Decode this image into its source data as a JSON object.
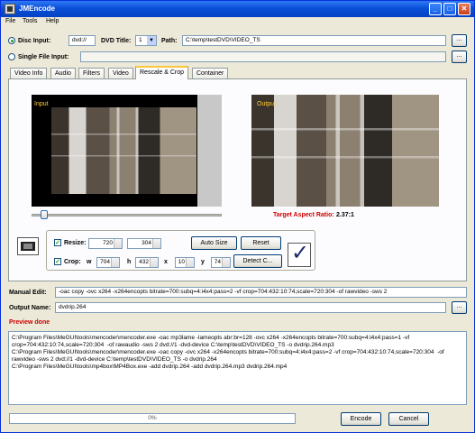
{
  "window": {
    "title": "JMEncode"
  },
  "menu": [
    "File",
    "Tools",
    "Help"
  ],
  "source": {
    "disc_label": "Disc Input:",
    "disc_value": "dvd://",
    "dvd_title_label": "DVD Title:",
    "dvd_title_value": "1",
    "path_label": "Path:",
    "path_value": "C:\\temp\\testDVD\\VIDEO_TS",
    "single_file_label": "Single File Input:",
    "browse_label": "..."
  },
  "tabs": [
    "Video Info",
    "Audio",
    "Filters",
    "Video",
    "Rescale & Crop",
    "Container"
  ],
  "active_tab": "Rescale & Crop",
  "preview": {
    "input_label": "Input",
    "output_label": "Output",
    "target_ratio_label": "Target Aspect Ratio:",
    "target_ratio_value": "2.37:1",
    "slider_position": 0.05
  },
  "rescale": {
    "resize_label": "Resize:",
    "resize_width": "720",
    "resize_height": "304",
    "crop_label": "Crop:",
    "w_label": "w",
    "w_value": "704",
    "h_label": "h",
    "h_value": "432",
    "x_label": "x",
    "x_value": "10",
    "y_label": "y",
    "y_value": "74",
    "auto_size": "Auto Size",
    "reset": "Reset",
    "detect": "Detect C..."
  },
  "manual_edit_label": "Manual Edit:",
  "manual_edit_value": "-oac copy -ovc x264 -x264encopts bitrate=700:subq=4:i4x4:pass=2 -vf crop=704:432:10:74,scale=720:304  -of rawvideo -sws 2",
  "output_name_label": "Output Name:",
  "output_name_value": "dvdrip.264",
  "preview_done": "Preview done",
  "log_lines": [
    "C:\\Program Files\\MeGUI\\tools\\mencoder\\mencoder.exe -oac mp3lame -lameopts abr:br=128 -ovc x264 -x264encopts bitrate=700:subq=4:i4x4:pass=1 -vf crop=704:432:10:74,scale=720:304  -of rawaudio -sws 2 dvd://1 -dvd-device C:\\temp\\testDVD\\VIDEO_TS -o dvdrip.264.mp3",
    "",
    "C:\\Program Files\\MeGUI\\tools\\mencoder\\mencoder.exe -oac copy -ovc x264 -x264encopts bitrate=700:subq=4:i4x4:pass=2 -vf crop=704:432:10:74,scale=720:304  -of rawvideo -sws 2 dvd://1 -dvd-device C:\\temp\\testDVD\\VIDEO_TS -o dvdrip.264",
    "",
    "C:\\Program Files\\MeGUI\\tools\\mp4box\\MP4Box.exe -add dvdrip.264 -add dvdrip.264.mp3 dvdrip.264.mp4"
  ],
  "progress": {
    "value": 0,
    "label": "0%"
  },
  "encode_label": "Encode",
  "cancel_label": "Cancel",
  "colors": {
    "title_bar": "#0a4fd8",
    "accent_red": "#cc0000",
    "output_text": "#ffcc33"
  }
}
